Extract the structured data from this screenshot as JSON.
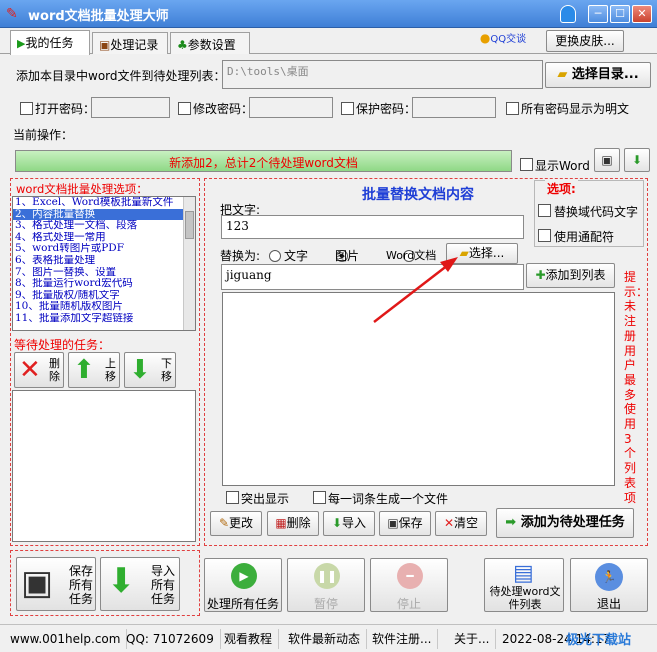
{
  "window": {
    "title": "word文档批量处理大师",
    "min": "─",
    "max": "☐",
    "close": "✕"
  },
  "tabs": [
    {
      "label": "我的任务"
    },
    {
      "label": "处理记录"
    },
    {
      "label": "参数设置"
    }
  ],
  "header": {
    "qq_label": "QQ交谈",
    "skin_button": "更换皮肤..."
  },
  "dir": {
    "label": "添加本目录中word文件到待处理列表：",
    "value": "D:\\tools\\桌面",
    "choose_button": "选择目录..."
  },
  "passwords": {
    "open_label": "打开密码：",
    "modify_label": "修改密码：",
    "protect_label": "保护密码：",
    "show_plain_label": "所有密码显示为明文"
  },
  "current_op_label": "当前操作：",
  "progress": {
    "text": "新添加2，总计2个待处理word文档",
    "fraction": 1.0
  },
  "show_word_label": "显示Word",
  "options": {
    "title": "word文档批量处理选项：",
    "items": [
      "1、Excel、Word模板批量新文件",
      "2、内容批量替换",
      "3、格式处理一文档、段落",
      "4、格式处理一常用",
      "5、word转图片或PDF",
      "6、表格批量处理",
      "7、图片一替换、设置",
      "8、批量运行word宏代码",
      "9、批量版权/随机文字",
      "10、批量随机版权图片",
      "11、批量添加文字超链接"
    ],
    "selected_index": 1
  },
  "pending": {
    "title": "等待处理的任务：",
    "delete": "删除",
    "up": "上移",
    "down": "下移"
  },
  "replace": {
    "title": "批量替换文档内容",
    "from_label": "把文字:",
    "from_value": "123",
    "to_label": "替换为:",
    "radio_text": "文字",
    "radio_image": "图片",
    "radio_word": "Word文档",
    "choose_button": "选择...",
    "to_value": "jiguang",
    "add_to_list": "添加到列表",
    "options_title": "选项:",
    "opt_field_code": "替换域代码文字",
    "opt_wildcard": "使用通配符",
    "hint": "提示：未注册用户最多使用3个列表项",
    "highlight": "突出显示",
    "one_file_each": "每一词条生成一个文件",
    "btn_edit": "更改",
    "btn_delete": "删除",
    "btn_import": "导入",
    "btn_save": "保存",
    "btn_clear": "清空",
    "btn_add_task": "添加为待处理任务"
  },
  "bottom": {
    "save_all": "保存所有任务",
    "import_all": "导入所有任务",
    "process_all": "处理所有任务",
    "pause": "暂停",
    "stop": "停止",
    "pending_list": "待处理word文件列表",
    "exit": "退出"
  },
  "status": {
    "website": "www.001help.com",
    "qq": "QQ: 71072609",
    "tutorial": "观看教程",
    "news": "软件最新动态",
    "register": "软件注册...",
    "about": "关于...",
    "datetime": "2022-08-24 14:17",
    "watermark": "极光下载站"
  }
}
